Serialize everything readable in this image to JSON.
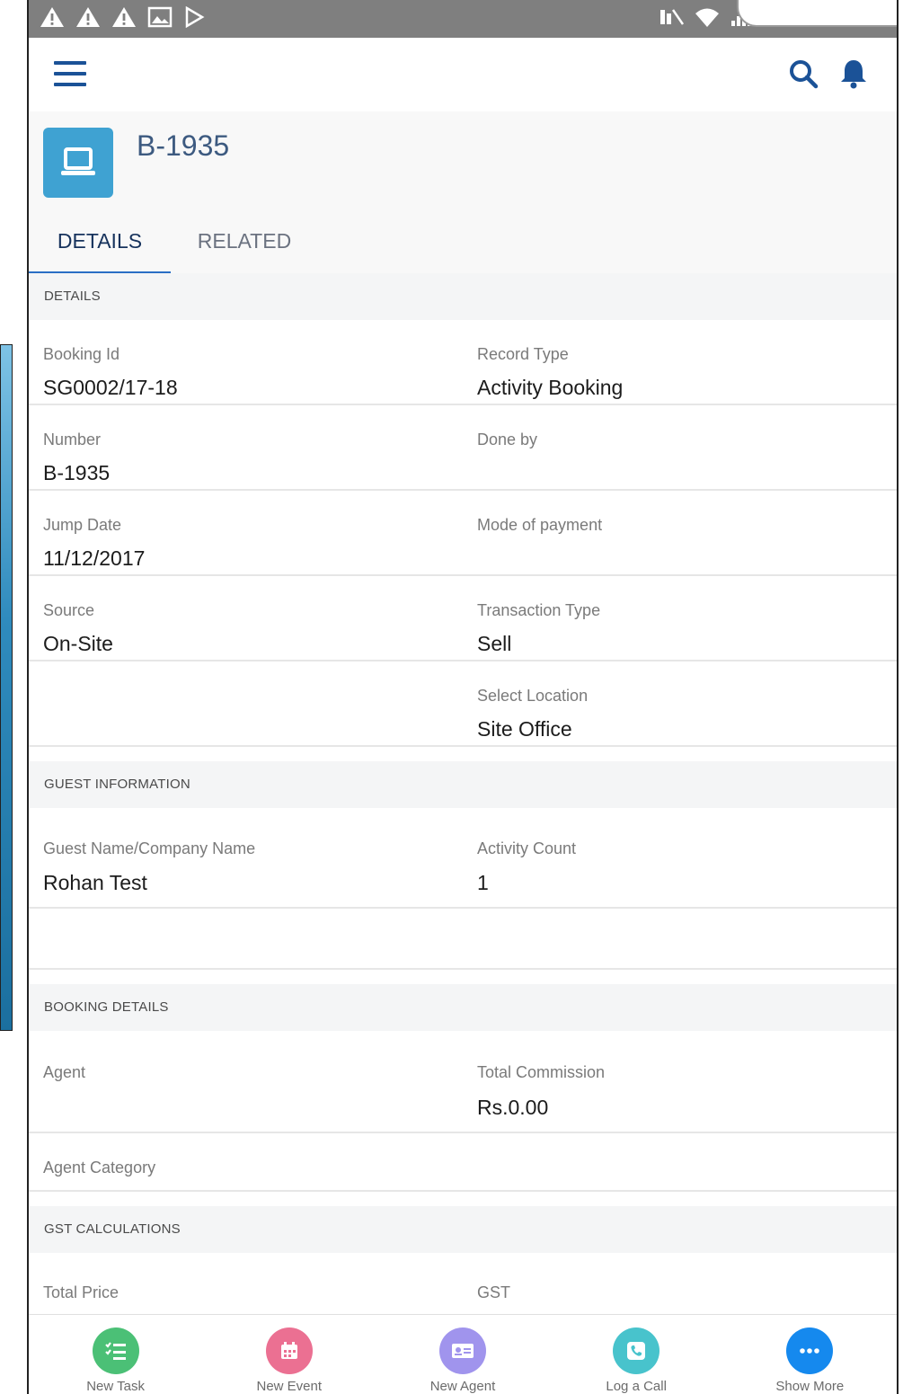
{
  "record": {
    "title": "B-1935",
    "icon": "laptop-icon"
  },
  "tabs": [
    {
      "label": "DETAILS"
    },
    {
      "label": "RELATED"
    }
  ],
  "sections": {
    "details": {
      "header": "DETAILS",
      "fields": {
        "booking_id": {
          "label": "Booking Id",
          "value": "SG0002/17-18"
        },
        "record_type": {
          "label": "Record Type",
          "value": "Activity Booking"
        },
        "number": {
          "label": "Number",
          "value": "B-1935"
        },
        "done_by": {
          "label": "Done by",
          "value": ""
        },
        "jump_date": {
          "label": "Jump Date",
          "value": "11/12/2017"
        },
        "mode_of_payment": {
          "label": "Mode of payment",
          "value": ""
        },
        "source": {
          "label": "Source",
          "value": "On-Site"
        },
        "transaction_type": {
          "label": "Transaction Type",
          "value": "Sell"
        },
        "select_location": {
          "label": "Select Location",
          "value": "Site Office"
        }
      }
    },
    "guest": {
      "header": "GUEST INFORMATION",
      "fields": {
        "guest_name": {
          "label": "Guest Name/Company Name",
          "value": "Rohan Test"
        },
        "activity_count": {
          "label": "Activity Count",
          "value": "1"
        }
      }
    },
    "booking": {
      "header": "BOOKING DETAILS",
      "fields": {
        "agent": {
          "label": "Agent",
          "value": ""
        },
        "total_commission": {
          "label": "Total Commission",
          "value": "Rs.0.00"
        },
        "agent_category": {
          "label": "Agent Category",
          "value": ""
        }
      }
    },
    "gst": {
      "header": "GST CALCULATIONS",
      "fields": {
        "total_price": {
          "label": "Total Price"
        },
        "gst": {
          "label": "GST"
        }
      }
    }
  },
  "actions": [
    {
      "label": "New Task",
      "icon": "task-list-icon",
      "color": "#4bc076"
    },
    {
      "label": "New Event",
      "icon": "calendar-icon",
      "color": "#eb7092"
    },
    {
      "label": "New Agent",
      "icon": "contact-card-icon",
      "color": "#a094ed"
    },
    {
      "label": "Log a Call",
      "icon": "phone-icon",
      "color": "#48c3cc"
    },
    {
      "label": "Show More",
      "icon": "more-icon",
      "color": "#1589ee"
    }
  ],
  "colors": {
    "brand": "#1b5297",
    "record_icon_bg": "#3fa2d2",
    "active_tab": "#2a6fc4"
  }
}
